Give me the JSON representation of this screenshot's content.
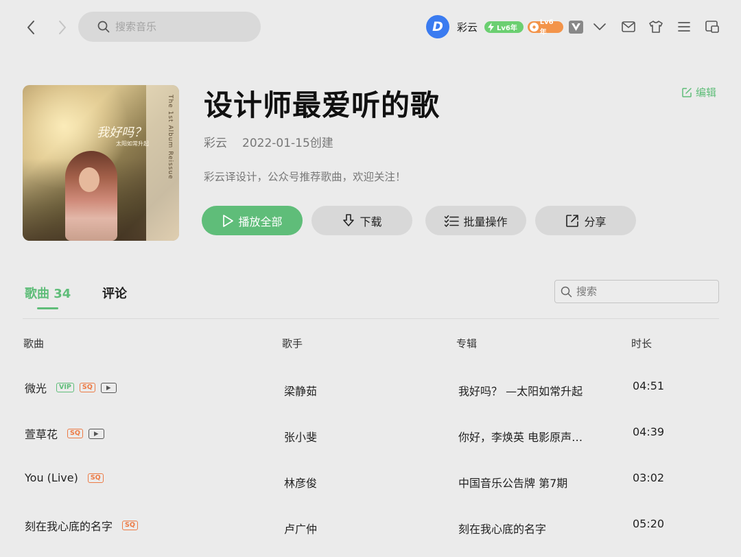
{
  "nav": {
    "search_placeholder": "搜索音乐"
  },
  "user": {
    "avatar_letter": "D",
    "name": "彩云",
    "level_badge_1": "Lv6年",
    "level_badge_2": "Lv6年",
    "colors": {
      "avatar": "#3a7bf0",
      "badge_green": "#6bcf71",
      "badge_orange": "#f3944a"
    }
  },
  "playlist": {
    "title": "设计师最爱听的歌",
    "creator": "彩云",
    "created": "2022-01-15创建",
    "description": "彩云译设计，公众号推荐歌曲，欢迎关注！",
    "edit_label": "编辑",
    "cover_caption": "我好吗？",
    "cover_sub": "太阳如常升起",
    "cover_side_text": "The 1st Album Reissue"
  },
  "actions": {
    "play_all": "播放全部",
    "download": "下载",
    "batch": "批量操作",
    "share": "分享"
  },
  "tabs": {
    "songs_label": "歌曲",
    "songs_count": "34",
    "comments": "评论"
  },
  "list_search": {
    "placeholder": "搜索"
  },
  "table": {
    "headers": {
      "title": "歌曲",
      "artist": "歌手",
      "album": "专辑",
      "duration": "时长"
    },
    "rows": [
      {
        "title": "微光",
        "tags": [
          "VIP",
          "SQ",
          "MV"
        ],
        "artist": "梁静茹",
        "album": "我好吗？ —太阳如常升起",
        "duration": "04:51"
      },
      {
        "title": "萱草花",
        "tags": [
          "SQ",
          "MV"
        ],
        "artist": "张小斐",
        "album": "你好，李焕英 电影原声…",
        "duration": "04:39"
      },
      {
        "title": "You (Live)",
        "tags": [
          "SQ"
        ],
        "artist": "林彦俊",
        "album": "中国音乐公告牌 第7期",
        "duration": "03:02"
      },
      {
        "title": "刻在我心底的名字",
        "tags": [
          "SQ"
        ],
        "artist": "卢广仲",
        "album": "刻在我心底的名字",
        "duration": "05:20"
      }
    ]
  },
  "theme": {
    "accent": "#5fbd79",
    "background": "#ebebeb",
    "sq_color": "#ec7a44"
  }
}
